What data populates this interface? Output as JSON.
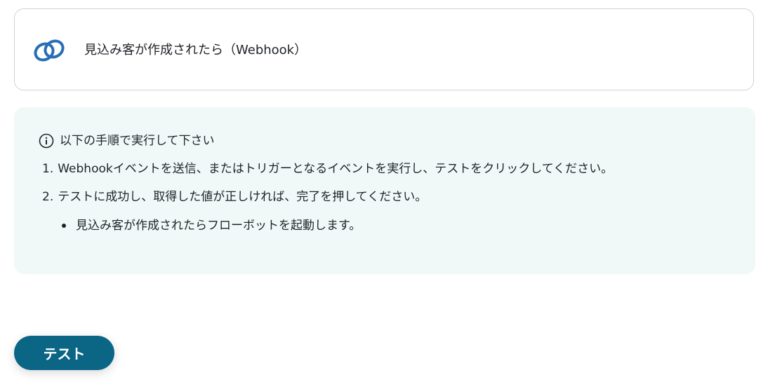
{
  "trigger": {
    "icon": "zoho-crm-icon",
    "label": "見込み客が作成されたら（Webhook）"
  },
  "info": {
    "icon": "info-icon",
    "heading": "以下の手順で実行して下さい",
    "steps": [
      {
        "num": "1.",
        "text": "Webhookイベントを送信、またはトリガーとなるイベントを実行し、テストをクリックしてください。"
      },
      {
        "num": "2.",
        "text": "テストに成功し、取得した値が正しければ、完了を押してください。"
      }
    ],
    "bullets": [
      "見込み客が作成されたらフローボットを起動します。"
    ]
  },
  "actions": {
    "test_label": "テスト"
  },
  "colors": {
    "brand_button": "#0b6584",
    "panel_bg": "#f1f9f8",
    "icon_blue": "#2a6db5"
  }
}
